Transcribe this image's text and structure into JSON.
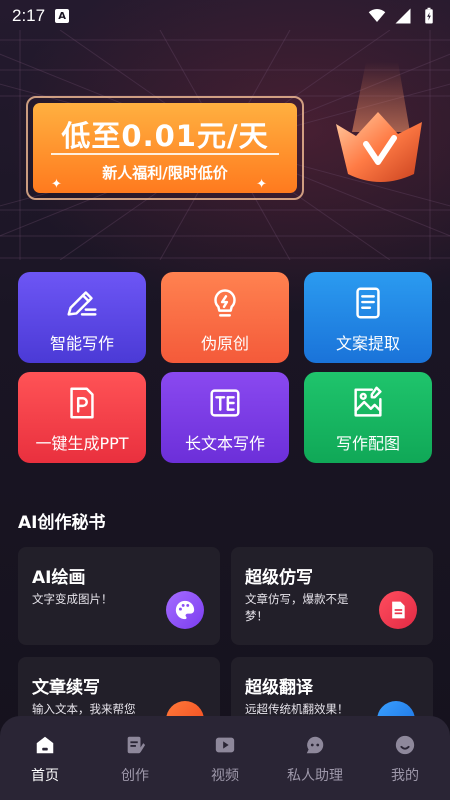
{
  "status_bar": {
    "time": "2:17",
    "notification_badge": "A"
  },
  "banner": {
    "title": "低至0.01元/天",
    "subtitle": "新人福利/限时低价"
  },
  "tools": [
    {
      "label": "智能写作",
      "icon": "pen-icon"
    },
    {
      "label": "伪原创",
      "icon": "bulb-icon"
    },
    {
      "label": "文案提取",
      "icon": "document-icon"
    },
    {
      "label": "一键生成PPT",
      "icon": "ppt-icon"
    },
    {
      "label": "长文本写作",
      "icon": "text-icon"
    },
    {
      "label": "写作配图",
      "icon": "image-icon"
    }
  ],
  "section": {
    "title": "AI创作秘书"
  },
  "cards": [
    {
      "title": "AI绘画",
      "desc": "文字变成图片！"
    },
    {
      "title": "超级仿写",
      "desc": "文章仿写，爆款不是梦！"
    },
    {
      "title": "文章续写",
      "desc": "输入文本，我来帮您"
    },
    {
      "title": "超级翻译",
      "desc": "远超传统机翻效果！"
    }
  ],
  "nav": [
    {
      "label": "首页",
      "active": true
    },
    {
      "label": "创作",
      "active": false
    },
    {
      "label": "视频",
      "active": false
    },
    {
      "label": "私人助理",
      "active": false
    },
    {
      "label": "我的",
      "active": false
    }
  ]
}
